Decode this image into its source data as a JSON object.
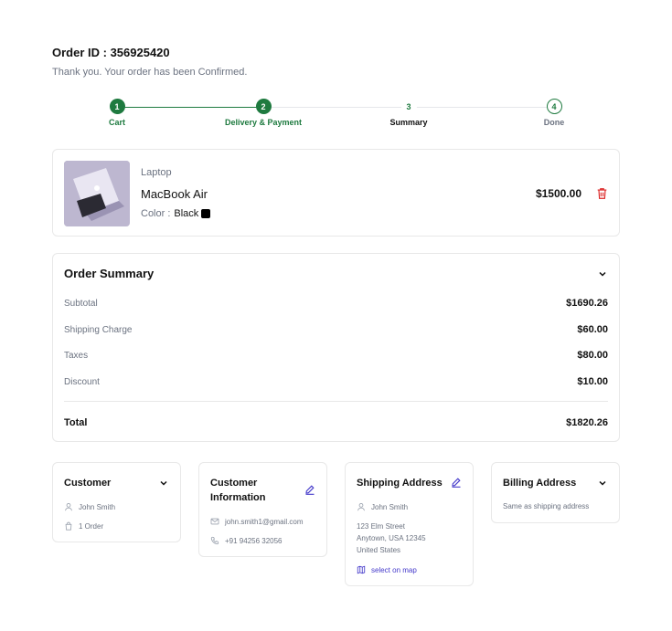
{
  "order": {
    "id_label": "Order ID : 356925420",
    "confirmation": "Thank you. Your order has been Confirmed."
  },
  "stepper": {
    "steps": [
      {
        "number": "1",
        "label": "Cart",
        "state": "completed"
      },
      {
        "number": "2",
        "label": "Delivery & Payment",
        "state": "completed"
      },
      {
        "number": "3",
        "label": "Summary",
        "state": "current"
      },
      {
        "number": "4",
        "label": "Done",
        "state": "upcoming"
      }
    ]
  },
  "product": {
    "category": "Laptop",
    "name": "MacBook Air",
    "color_label": "Color :",
    "color_value": "Black",
    "color_swatch": "#000000",
    "price": "$1500.00",
    "delete_icon": "trash-icon"
  },
  "summary": {
    "title": "Order Summary",
    "toggle_icon": "chevron-down-icon",
    "rows": [
      {
        "label": "Subtotal",
        "value": "$1690.26"
      },
      {
        "label": "Shipping Charge",
        "value": "$60.00"
      },
      {
        "label": "Taxes",
        "value": "$80.00"
      },
      {
        "label": "Discount",
        "value": "$10.00"
      }
    ],
    "total": {
      "label": "Total",
      "value": "$1820.26"
    }
  },
  "customer": {
    "title": "Customer",
    "name": "John Smith",
    "orders": "1 Order"
  },
  "customer_info": {
    "title_line1": "Customer",
    "title_line2": "Information",
    "email": "john.smith1@gmail.com",
    "phone": "+91 94256 32056"
  },
  "shipping": {
    "title": "Shipping Address",
    "name": "John Smith",
    "line1": "123 Elm Street",
    "line2": "Anytown, USA 12345",
    "line3": "United States",
    "map_link": "select on map"
  },
  "billing": {
    "title": "Billing Address",
    "note": "Same as shipping address"
  },
  "colors": {
    "accent_green": "#1e7a3f",
    "link_indigo": "#4338ca",
    "delete_red": "#dc2626"
  }
}
